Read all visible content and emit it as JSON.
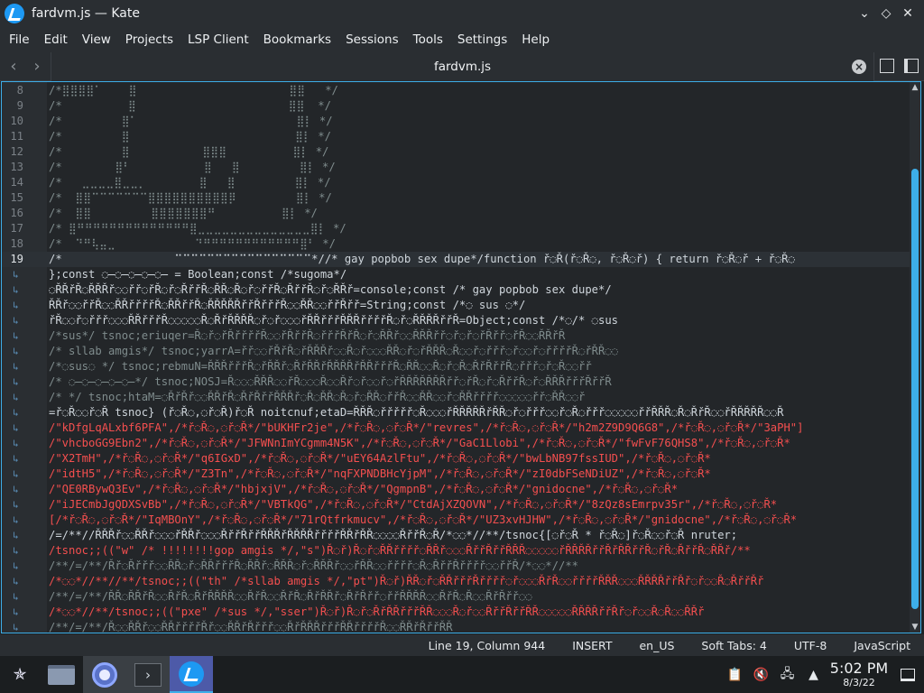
{
  "window": {
    "title": "fardvm.js — Kate",
    "controls": [
      "chevron-down",
      "diamond",
      "close"
    ]
  },
  "menu": [
    "File",
    "Edit",
    "View",
    "Projects",
    "LSP Client",
    "Bookmarks",
    "Sessions",
    "Tools",
    "Settings",
    "Help"
  ],
  "tab": {
    "label": "fardvm.js"
  },
  "editor": {
    "active_line": 19,
    "lines": [
      {
        "n": "8",
        "text": "/*⣿⣿⣿⣿⠁    ⣿                       ⣿⣿   */"
      },
      {
        "n": "9",
        "text": "/*          ⣿                       ⣿⣿  */"
      },
      {
        "n": "10",
        "text": "/*         ⣿⠁                        ⣿⡇ */"
      },
      {
        "n": "11",
        "text": "/*         ⣿                         ⣿⡇ */"
      },
      {
        "n": "12",
        "text": "/*         ⣿           ⣿⣿⣿          ⣿⡇ */"
      },
      {
        "n": "13",
        "text": "/*        ⣿⠃           ⣿   ⣿         ⣿⡇ */"
      },
      {
        "n": "14",
        "text": "/*   ⣀⣀⣀⣀⣿⣀⣀⡀        ⣿   ⣿         ⣿⡇ */"
      },
      {
        "n": "15",
        "text": "/*  ⣿⣿⠉⠉⠉⠉⠉⠉⠉⣿⣿⣿⣿⣿⣿⣿⣿⣿⣿⡿         ⣿⡇ */"
      },
      {
        "n": "16",
        "text": "/*  ⣿⣿         ⣿⣿⣿⣿⣿⣿⣿⠛          ⣿⡇ */"
      },
      {
        "n": "17",
        "text": "/* ⣿⠛⠛⠛⠛⠛⠛⠛⠛⠛⠛⠛⠛⠛⠛⣿⣀⣀⣀⣀⣀⣀⣀⣀⣀⣀⣀⣀⣀⣀⣿⡇ */"
      },
      {
        "n": "18",
        "text": "/*  ⠙⠛⢧⣤⣀            ⠙⠛⠛⠛⠛⠛⠛⠛⠛⠛⠛⠛⠛⣿⠃ */"
      },
      {
        "n": "19",
        "text": "/*                 ⠉⠉⠉⠉⠉⠉⠉⠉⠉⠉⠉⠉⠉⠉⠉⠉⠉*//* gay popbob sex dupe*/function ř◌Ř(ř◌Ř◌, ř◌Ř◌ř) { return ř◌Ř◌ř + ř◌Ř◌"
      },
      {
        "n": "",
        "text": "};const ◌̶◌̶◌̶◌̶◌̶ = Boolean;const /*sugoma*/"
      },
      {
        "n": "",
        "text": "◌ŘŘřŘ◌ŘŘŘř◌◌řř◌řŘ◌ř◌ŘřřŘ◌ŘŘ◌Ř◌ř◌řřŘ◌ŘřřŘ◌ř◌ŘŘř=console;const /* gay popbob sex dupe*/"
      },
      {
        "n": "",
        "text": "ŘŘř◌◌řřŘ◌◌ŘŘřřřřŘ◌ŘŘřřŘ◌ŘŘŘŘŘřřŘřřřŘ◌◌ŘŘ◌◌řřŘřř=String;const /*◌ sus ◌*/"
      },
      {
        "n": "",
        "text": "řŘ◌◌ř◌řřř◌◌◌ŘŘřřřŘ◌◌◌◌◌Ř◌ŘřŘŘŘŘ◌ř◌ř◌◌◌řŘŘřřřŘŘŘřřřřŘ◌ř◌ŘŘŘŘřřŘ=Object;const /*◌/* ◌sus"
      },
      {
        "n": "",
        "text": "/*sus*/ tsnoc;eriuqer=Ř◌ř◌řŘřřřřŘ◌◌řŘřřŘ◌řřřŘřŘ◌ř◌ŘŘř◌◌ŘŘŘřř◌ř◌ř◌řŘřř◌řŘ◌◌ŘŘřŘ"
      },
      {
        "n": "",
        "text": "/* sllab amgis*/ tsnoc;yarrA=řř◌◌řŘřŘ◌řŘŘŘř◌◌Ř◌ř◌◌◌ŘŘ◌ř◌řŘŘŘ◌Ř◌◌ř◌řřř◌ř◌◌ř◌řřřřŘ◌řŘŘ◌◌"
      },
      {
        "n": "",
        "text": "/*◌sus◌ */ tsnoc;rebmuN=ŘŘŘřřřŘ◌řŘŘř◌ŘřŘŘřŘŘŘŘřŘŘřřřŘ◌ŘŘ◌◌Ř◌ř◌Ř◌ŘřŘřřŘ◌řřř◌ř◌Ř◌◌řř"
      },
      {
        "n": "",
        "text": "/* ◌̶◌̶◌̶◌̶◌̶*/ tsnoc;NOSJ=Ř◌◌◌ŘŘŘ◌◌řŘ◌◌◌Ř◌◌Řř◌ř◌◌ř◌řŘŘŘŘŘŘŘřř◌řŘ◌ř◌ŘřřŘ◌ř◌ŘŘŘřřřŘřřŘ"
      },
      {
        "n": "",
        "text": "/* */ tsnoc;htaM=◌ŘřŘř◌◌ŘŘřŘ◌ŘřŘřřŘŘŘř◌Ř◌ŘŘ◌Ř◌ř◌ŘŘ◌řřŘ◌◌ŘŘ◌◌ř◌ŘŘřřřř◌◌◌◌◌řř◌ŘŘ◌◌ř"
      },
      {
        "n": "",
        "text": "=ř◌Ř◌◌ř◌Ř tsnoc} (ř◌Ř◌,◌ř◌Ř)ř◌Ř noitcnuf;etaD=ŘŘŘ◌řřřřř◌Ř◌◌◌řŘŘŘŘŘřŘŘ◌ř◌řřř◌◌ř◌Ř◌řřř◌◌◌◌◌řřŘŘŘ◌Ř◌ŘřŘ◌◌řŘŘŘŘŘ◌◌Ř"
      },
      {
        "n": "",
        "text": "/\"kDfgLqALxbf6PFA\",/*ř◌Ř◌,◌ř◌Ř*/\"bUKHFr2je\",/*ř◌Ř◌,◌ř◌Ř*/\"revres\",/*ř◌Ř◌,◌ř◌Ř*/\"h2m2Z9D9Q6G8\",/*ř◌Ř◌,◌ř◌Ř*/\"3aPH\"]"
      },
      {
        "n": "",
        "text": "/\"vhcboGG9Ebn2\",/*ř◌Ř◌,◌ř◌Ř*/\"JFWNnImYCgmm4N5K\",/*ř◌Ř◌,◌ř◌Ř*/\"GaC1Llobi\",/*ř◌Ř◌,◌ř◌Ř*/\"fwFvF76QHS8\",/*ř◌Ř◌,◌ř◌Ř*"
      },
      {
        "n": "",
        "text": "/\"X2TmH\",/*ř◌Ř◌,◌ř◌Ř*/\"q6IGxD\",/*ř◌Ř◌,◌ř◌Ř*/\"uEY64AzlFtu\",/*ř◌Ř◌,◌ř◌Ř*/\"bwLbNB97fssIUD\",/*ř◌Ř◌,◌ř◌Ř*"
      },
      {
        "n": "",
        "text": "/\"idtH5\",/*ř◌Ř◌,◌ř◌Ř*/\"Z3Tn\",/*ř◌Ř◌,◌ř◌Ř*/\"nqFXPNDBHcYjpM\",/*ř◌Ř◌,◌ř◌Ř*/\"zI0dbFSeNDiUZ\",/*ř◌Ř◌,◌ř◌Ř*"
      },
      {
        "n": "",
        "text": "/\"QE0RBywQ3Ev\",/*ř◌Ř◌,◌ř◌Ř*/\"hbjxjV\",/*ř◌Ř◌,◌ř◌Ř*/\"QgmpnB\",/*ř◌Ř◌,◌ř◌Ř*/\"gnidocne\",/*ř◌Ř◌,◌ř◌Ř*"
      },
      {
        "n": "",
        "text": "/\"iJECmbJgQDXSvBb\",/*ř◌Ř◌,◌ř◌Ř*/\"VBTkQG\",/*ř◌Ř◌,◌ř◌Ř*/\"CtdAjXZQOVN\",/*ř◌Ř◌,◌ř◌Ř*/\"8zQz8sEmrpv35r\",/*ř◌Ř◌,◌ř◌Ř*"
      },
      {
        "n": "",
        "text": "[/*ř◌Ř◌,◌ř◌Ř*/\"IqMBOnY\",/*ř◌Ř◌,◌ř◌Ř*/\"71rQtfrkmucv\",/*ř◌Ř◌,◌ř◌Ř*/\"UZ3xvHJHW\",/*ř◌Ř◌,◌ř◌Ř*/\"gnidocne\",/*ř◌Ř◌,◌ř◌Ř*"
      },
      {
        "n": "",
        "text": "/=/**//ŘŘŘř◌◌ŘŘř◌◌◌řŘŘř◌◌◌ŘřřŘřřŘŘŘřŘŘŘŘřřřřŘŘřŘŘ◌◌◌◌ŘřřŘ◌Ř/*◌◌*//**/tsnoc{[◌ř◌Ř * ř◌Ř◌]ř◌Ř◌◌ř◌Ř nruter;"
      },
      {
        "n": "",
        "text": "/tsnoc;;((\"w\" /* !!!!!!!!gop amgis */,\"s\")Ř◌ř)Ř◌ř◌ŘŘřřřř◌ŘŘř◌◌◌ŘřřŘřřŘŘŘ◌◌◌◌◌řŘŘŘŘřřŘřŘŘřřŘ◌řŘ◌ŘřřŘ◌ŘŘř/**"
      },
      {
        "n": "",
        "text": "/**/=/**/Řř◌Řřřř◌◌ŘŘ◌ř◌ŘŘřřřŘ◌ŘŘř◌ŘŘŘ◌ř◌ŘŘŘř◌◌řŘŘ◌◌řřřř◌Ř◌ŘřřŘřřřř◌◌řřŘ/*◌◌*//**"
      },
      {
        "n": "",
        "text": "/*◌◌*//**//**/tsnoc;;((\"th\" /*sllab amgis */,\"pt\")Ř◌ř)ŘŘ◌ř◌ŘŘřřřŘřřřř◌ř◌◌◌ŘřŘ◌◌řřřřŘŘŘ◌◌◌ŘŘŘŘřřŘř◌ř◌◌Ř◌ŘřřŘř"
      },
      {
        "n": "",
        "text": "/**/=/**/ŘŘ◌ŘŘřŘ◌◌ŘřŘ◌ŘřŘŘŘŘ◌◌ŘřŘ◌◌ŘřŘ◌ŘřŘŘř◌ŘřŘřř◌řřŘŘŘŘ◌◌ŘřŘ◌Ř◌◌ŘřŘřř◌◌"
      },
      {
        "n": "",
        "text": "/*◌◌*//**/tsnoc;;((\"pxe\" /*sus */,\"sser\")Ř◌ř)Ř◌ř◌ŘřŘŘřřřŘŘ◌◌◌Ř◌ř◌◌ŘřřŘřřŘŘ◌◌◌◌◌ŘŘŘŘřřŘř◌ř◌◌Ř◌Ř◌◌ŘŘř"
      },
      {
        "n": "",
        "text": "/**/=/**/Ř◌◌ŘŘř◌◌ŘŘřřřřŘř◌◌ŘŘřŘřřř◌◌ŘřŘŘŘřřřŘŘřřřřŘ◌◌ŘŘřŘřřŘŘ"
      }
    ]
  },
  "status": {
    "position": "Line 19, Column 944",
    "mode": "INSERT",
    "dictionary": "en_US",
    "indent": "Soft Tabs: 4",
    "encoding": "UTF-8",
    "language": "JavaScript"
  },
  "taskbar": {
    "time": "5:02 PM",
    "date": "8/3/22"
  }
}
